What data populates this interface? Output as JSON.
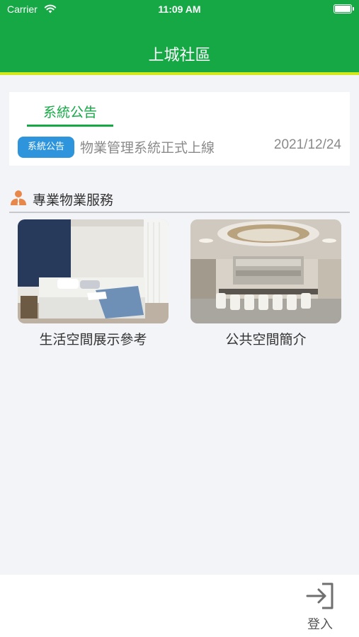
{
  "status_bar": {
    "carrier": "Carrier",
    "time": "11:09 AM"
  },
  "nav": {
    "title": "上城社區"
  },
  "announcement": {
    "tab_label": "系統公告",
    "badge": "系統公告",
    "title": "物業管理系統正式上線",
    "date": "2021/12/24"
  },
  "services": {
    "heading": "專業物業服務",
    "items": [
      {
        "label": "生活空間展示參考",
        "image": "bedroom-photo"
      },
      {
        "label": "公共空間簡介",
        "image": "dining-hall-photo"
      }
    ]
  },
  "bottom": {
    "login_label": "登入"
  },
  "colors": {
    "primary": "#15a845",
    "accent_line": "#d3e71a",
    "badge": "#2e95dd",
    "icon": "#e8874a"
  }
}
